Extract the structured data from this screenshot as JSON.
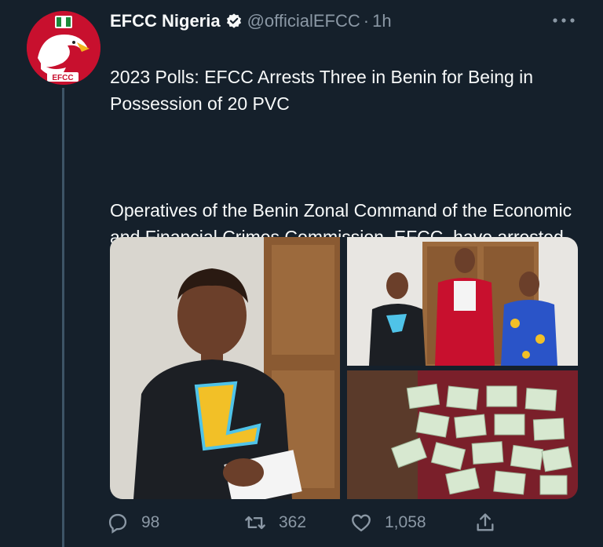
{
  "tweet": {
    "display_name": "EFCC Nigeria",
    "handle": "@officialEFCC",
    "separator": "·",
    "time": "1h",
    "title_line": "2023 Polls: EFCC Arrests Three in Benin for Being in Possession of 20 PVC",
    "body": "Operatives of the Benin Zonal Command of the Economic and Financial Crimes Commission, EFCC,  have arrested three persons for being in possession of several permanent voter cards.",
    "avatar_label": "EFCC"
  },
  "actions": {
    "replies": "98",
    "retweets": "362",
    "likes": "1,058"
  },
  "colors": {
    "background": "#15202b",
    "text": "#f7f9f9",
    "muted": "#8b98a5",
    "verified": "#f7f9f9",
    "avatar_red": "#c8102e"
  },
  "icons": {
    "verified": "verified-badge-icon",
    "more": "more-dots-icon",
    "reply": "reply-icon",
    "retweet": "retweet-icon",
    "like": "like-icon",
    "share": "share-icon"
  }
}
